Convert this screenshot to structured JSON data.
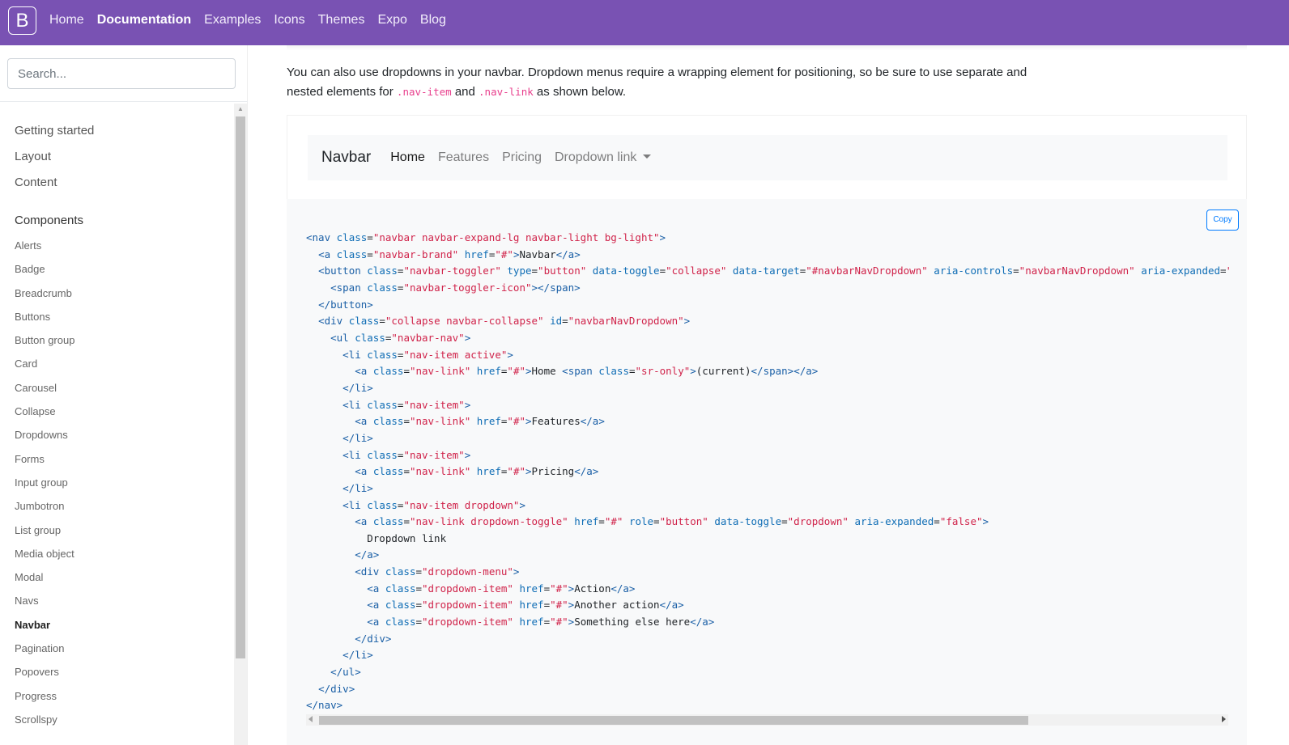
{
  "topnav": {
    "brand": "B",
    "links": [
      "Home",
      "Documentation",
      "Examples",
      "Icons",
      "Themes",
      "Expo",
      "Blog"
    ],
    "active": "Documentation",
    "color": "#7952b3"
  },
  "sidebar": {
    "search_placeholder": "Search...",
    "sections": [
      "Getting started",
      "Layout",
      "Content"
    ],
    "group_title": "Components",
    "items": [
      "Alerts",
      "Badge",
      "Breadcrumb",
      "Buttons",
      "Button group",
      "Card",
      "Carousel",
      "Collapse",
      "Dropdowns",
      "Forms",
      "Input group",
      "Jumbotron",
      "List group",
      "Media object",
      "Modal",
      "Navs",
      "Navbar",
      "Pagination",
      "Popovers",
      "Progress",
      "Scrollspy"
    ],
    "active_item": "Navbar"
  },
  "content": {
    "lead_part1": "You can also use dropdowns in your navbar. Dropdown menus require a wrapping element for positioning, so be sure to use separate and nested elements for ",
    "lead_code1": ".nav-item",
    "lead_part2": " and ",
    "lead_code2": ".nav-link",
    "lead_part3": " as shown below.",
    "demo": {
      "brand": "Navbar",
      "links": [
        "Home",
        "Features",
        "Pricing"
      ],
      "dropdown": "Dropdown link"
    },
    "copy_label": "Copy"
  }
}
